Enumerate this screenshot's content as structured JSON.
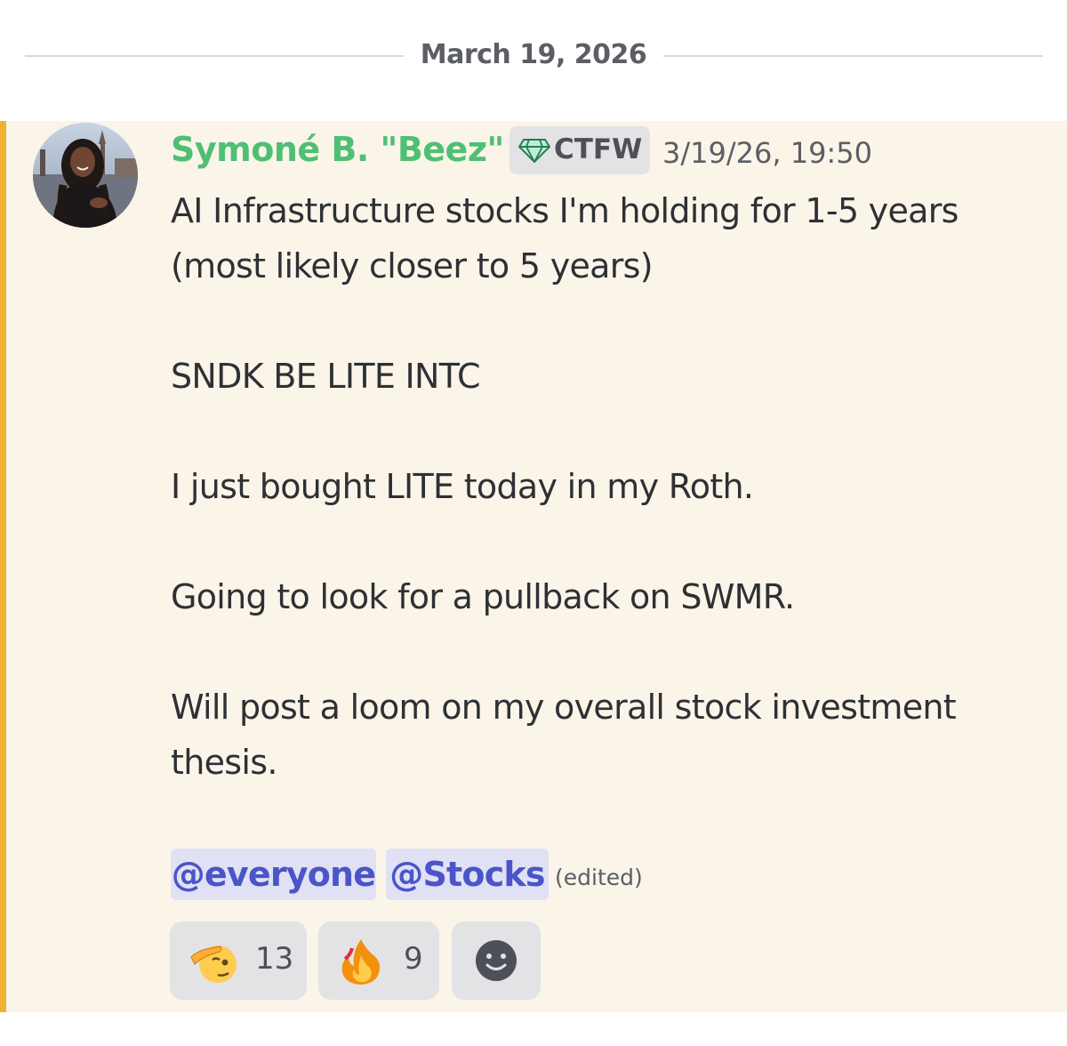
{
  "date_divider": {
    "label": "March 19, 2026"
  },
  "message": {
    "author": {
      "name": "Symoné B. \"Beez\"",
      "name_color": "#4fbf73",
      "role_tag": {
        "icon": "gem-icon",
        "label": "CTFW"
      },
      "avatar": "avatar-photo"
    },
    "timestamp": "3/19/26, 19:50",
    "lines": [
      "AI Infrastructure stocks I'm holding for 1-5 years",
      "(most likely closer to 5 years)",
      "SNDK BE LITE INTC",
      "I just bought LITE today in my Roth.",
      "Going to look for a pullback on SWMR.",
      "Will post a loom on my overall stock investment",
      "thesis."
    ],
    "mentions": [
      "@everyone",
      "@Stocks"
    ],
    "edited_label": "(edited)",
    "highlight_color": "#faf5e8",
    "accent_color": "#f0b232",
    "mention_color": "#4a55c9"
  },
  "reactions": [
    {
      "emoji": "saluting-face-icon",
      "count": "13"
    },
    {
      "emoji": "fire-icon",
      "count": "9"
    },
    {
      "emoji": "add-reaction-icon"
    }
  ]
}
